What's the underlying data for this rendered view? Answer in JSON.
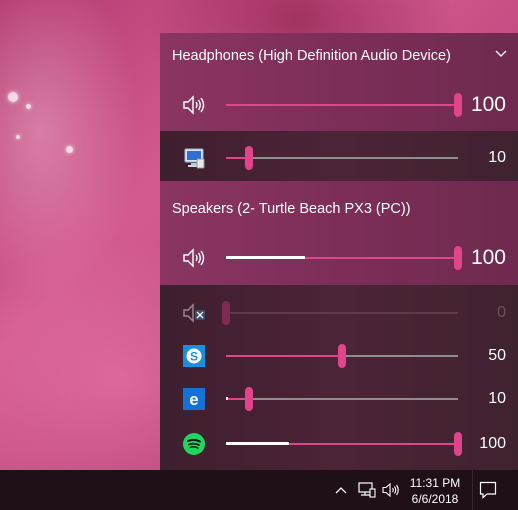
{
  "devices": [
    {
      "name": "Headphones (High Definition Audio Device)",
      "master_icon": "speaker-icon",
      "master_volume": 100,
      "master_volume_label": "100",
      "apps": [
        {
          "icon": "system-sounds-icon",
          "volume": 10,
          "volume_label": "10"
        }
      ]
    },
    {
      "name": "Speakers (2- Turtle Beach PX3 (PC))",
      "master_icon": "speaker-icon",
      "master_volume": 100,
      "master_volume_label": "100",
      "apps": [
        {
          "icon": "muted-app-icon",
          "volume": 0,
          "volume_label": "0",
          "muted": true
        },
        {
          "icon": "skype-icon",
          "volume": 50,
          "volume_label": "50"
        },
        {
          "icon": "edge-icon",
          "volume": 10,
          "volume_label": "10"
        },
        {
          "icon": "spotify-icon",
          "volume": 100,
          "volume_label": "100"
        }
      ]
    }
  ],
  "taskbar": {
    "time": "11:31 PM",
    "date": "6/6/2018",
    "tray_icons": [
      "chevron-up-icon",
      "network-icon",
      "volume-icon",
      "action-center-icon"
    ]
  },
  "colors": {
    "accent": "#e0448a",
    "panel_bg": "#4a2336",
    "header_bg": "#7a2d56",
    "taskbar_bg": "#1f0f17"
  }
}
